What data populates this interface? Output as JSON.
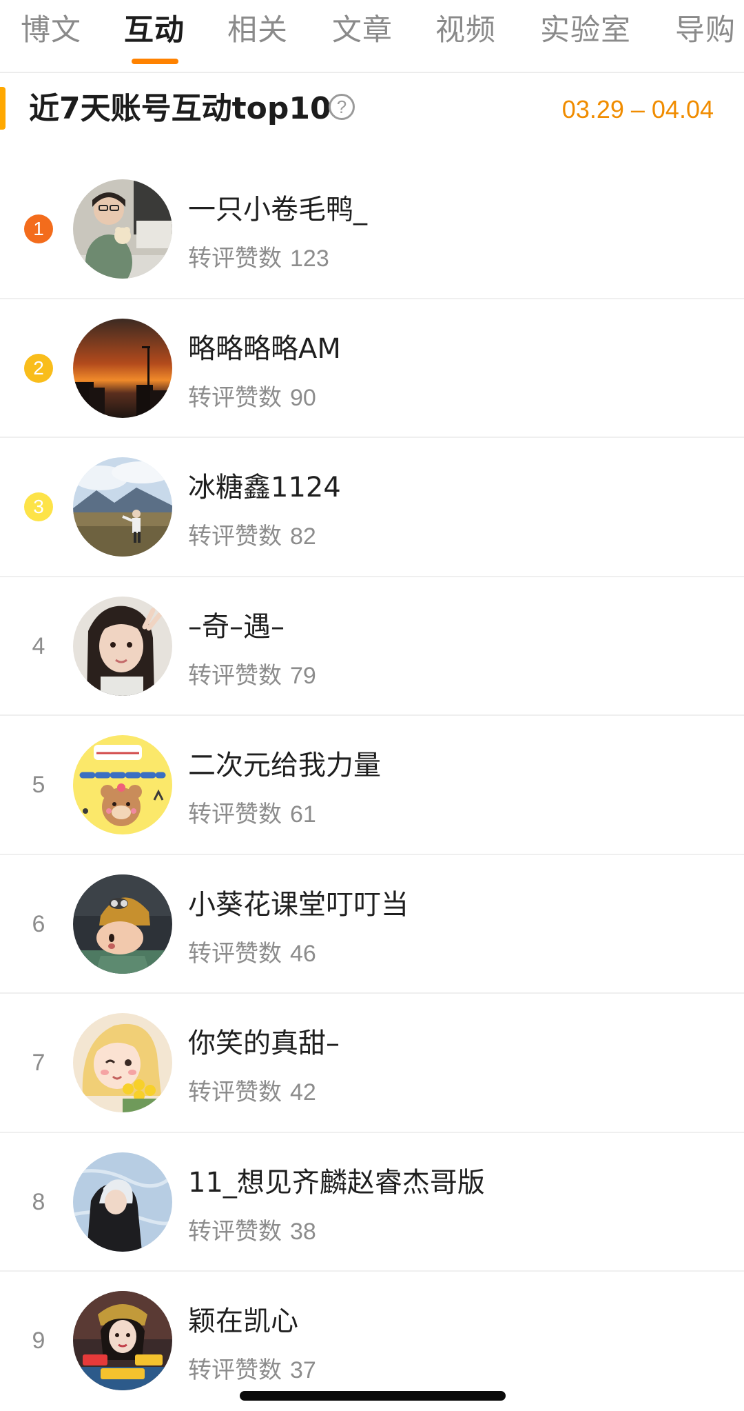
{
  "tabs": [
    {
      "label": "博文"
    },
    {
      "label": "互动"
    },
    {
      "label": "相关"
    },
    {
      "label": "文章"
    },
    {
      "label": "视频"
    },
    {
      "label": "实验室"
    },
    {
      "label": "导购"
    }
  ],
  "active_tab_index": 1,
  "header": {
    "title": "近7天账号互动top10",
    "help_glyph": "?",
    "date_range": "03.29 – 04.04"
  },
  "stat_label": "转评赞数",
  "accent_colors": {
    "tab_underline": "#ff8200",
    "header_bar": "#ffa800",
    "date_range": "#f08c00",
    "rank_1": "#f36c1c",
    "rank_2": "#f9bd1b",
    "rank_3": "#fde348"
  },
  "ranking": [
    {
      "rank": "1",
      "name": "一只小卷毛鸭_",
      "count": "123",
      "badge": "orange"
    },
    {
      "rank": "2",
      "name": "略略略略AM",
      "count": "90",
      "badge": "gold"
    },
    {
      "rank": "3",
      "name": "冰糖鑫1124",
      "count": "82",
      "badge": "yellow"
    },
    {
      "rank": "4",
      "name": "–奇–遇–",
      "count": "79",
      "badge": "plain"
    },
    {
      "rank": "5",
      "name": "二次元给我力量",
      "count": "61",
      "badge": "plain"
    },
    {
      "rank": "6",
      "name": "小葵花课堂叮叮当",
      "count": "46",
      "badge": "plain"
    },
    {
      "rank": "7",
      "name": "你笑的真甜–",
      "count": "42",
      "badge": "plain"
    },
    {
      "rank": "8",
      "name": "11_想见齐麟赵睿杰哥版",
      "count": "38",
      "badge": "plain"
    },
    {
      "rank": "9",
      "name": "颖在凯心",
      "count": "37",
      "badge": "plain"
    }
  ]
}
